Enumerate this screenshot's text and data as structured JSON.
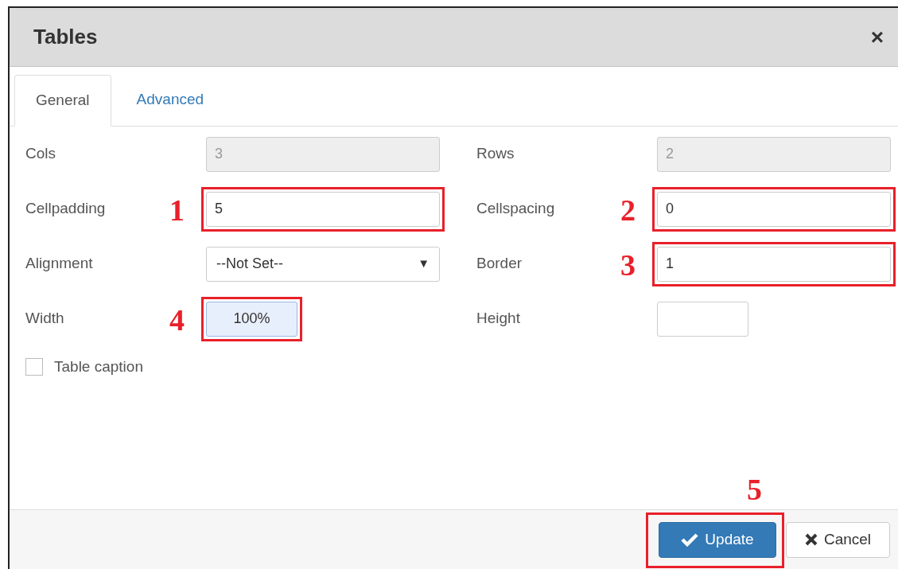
{
  "dialog": {
    "title": "Tables",
    "close": "×"
  },
  "tabs": [
    {
      "label": "General",
      "selected": true
    },
    {
      "label": "Advanced",
      "selected": false
    }
  ],
  "fields": [
    {
      "label": "Cols",
      "value": "3",
      "kind": "text",
      "disabled": true,
      "focused": false
    },
    {
      "label": "Rows",
      "value": "2",
      "kind": "text",
      "disabled": true,
      "focused": false
    },
    {
      "label": "Cellpadding",
      "value": "5",
      "kind": "text",
      "disabled": false,
      "focused": false,
      "callout": "1"
    },
    {
      "label": "Cellspacing",
      "value": "0",
      "kind": "text",
      "disabled": false,
      "focused": false,
      "callout": "2"
    },
    {
      "label": "Alignment",
      "value": "--Not Set--",
      "kind": "select",
      "disabled": false,
      "focused": false,
      "arrow": "▼"
    },
    {
      "label": "Border",
      "value": "1",
      "kind": "text",
      "disabled": false,
      "focused": false,
      "callout": "3"
    },
    {
      "label": "Width",
      "value": "100%",
      "kind": "short",
      "disabled": false,
      "focused": true,
      "callout": "4"
    },
    {
      "label": "Height",
      "kind": "short",
      "disabled": false,
      "focused": false
    }
  ],
  "caption": {
    "label": "Table caption",
    "checked": false
  },
  "buttons": [
    {
      "label": "Update",
      "kind": "primary",
      "callout": "5"
    },
    {
      "label": "Cancel",
      "kind": "default"
    }
  ]
}
